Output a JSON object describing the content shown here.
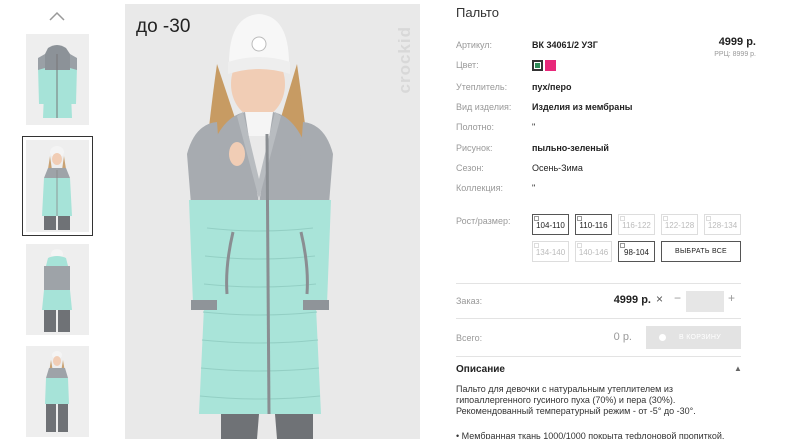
{
  "gallery": {
    "up_icon": "chevron-up-icon",
    "thumbnails": [
      {
        "alt": "coat-front"
      },
      {
        "alt": "coat-model-front",
        "selected": true
      },
      {
        "alt": "coat-model-back"
      },
      {
        "alt": "coat-model-full"
      }
    ]
  },
  "photo": {
    "badge": "до -30",
    "brand": "crockid"
  },
  "product": {
    "title": "Пальто",
    "price": "4999 р.",
    "rrp": "РРЦ: 8999 р.",
    "fields": [
      {
        "label": "Артикул:",
        "value": "ВК 34061/2 УЗГ",
        "bold": true
      },
      {
        "label": "Цвет:",
        "value": ""
      },
      {
        "label": "Утеплитель:",
        "value": "пух/перо",
        "bold": true
      },
      {
        "label": "Вид изделия:",
        "value": "Изделия из мембраны",
        "bold": true
      },
      {
        "label": "Полотно:",
        "value": "\"",
        "bold": false
      },
      {
        "label": "Рисунок:",
        "value": "пыльно-зеленый",
        "bold": true
      },
      {
        "label": "Сезон:",
        "value": "Осень-Зима",
        "bold": false
      },
      {
        "label": "Коллекция:",
        "value": "\"",
        "bold": false
      }
    ],
    "colors": [
      "#2e8b57",
      "#e8287a"
    ],
    "size_label": "Рост/размер:",
    "sizes": [
      {
        "label": "104-110",
        "available": true
      },
      {
        "label": "110-116",
        "available": true
      },
      {
        "label": "116-122",
        "available": false
      },
      {
        "label": "122-128",
        "available": false
      },
      {
        "label": "128-134",
        "available": false
      },
      {
        "label": "134-140",
        "available": false
      },
      {
        "label": "140-146",
        "available": false
      },
      {
        "label": "98-104",
        "available": true
      }
    ],
    "select_all": "ВЫБРАТЬ ВСЕ"
  },
  "order": {
    "label": "Заказ:",
    "price": "4999 р.",
    "remove": "×",
    "minus": "−",
    "plus": "+",
    "qty": ""
  },
  "total": {
    "label": "Всего:",
    "value": "0 р.",
    "cart_button": "В КОРЗИНУ"
  },
  "description": {
    "heading": "Описание",
    "caret": "▲",
    "text": "Пальто для девочки с натуральным утеплителем из гипоаллергенного гусиного пуха (70%) и пера (30%). Рекомендованный температурный режим - от -5° до -30°.",
    "bullet": "• Мембранная ткань 1000/1000 покрыта тефлоновой пропиткой,"
  }
}
